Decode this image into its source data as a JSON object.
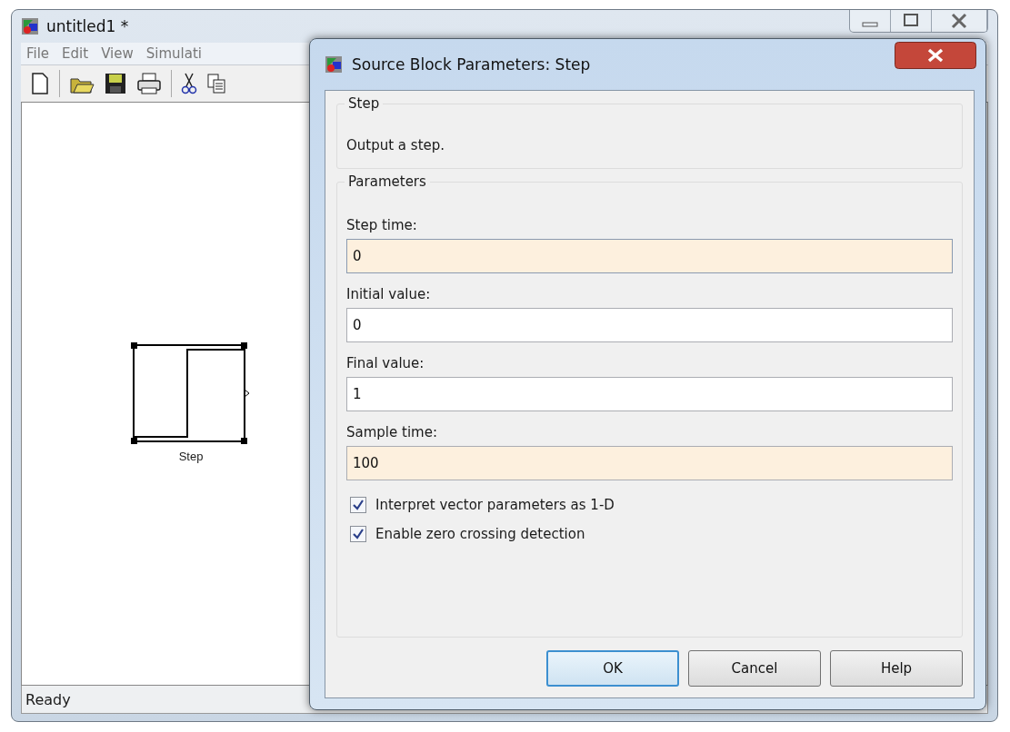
{
  "main_window": {
    "title": "untitled1 *",
    "menu": [
      {
        "label": "File"
      },
      {
        "label": "Edit"
      },
      {
        "label": "View"
      },
      {
        "label": "Simulati"
      }
    ],
    "canvas": {
      "blocks": [
        {
          "label": "Step",
          "selected": true
        }
      ]
    },
    "status_bar": {
      "text": "Ready"
    }
  },
  "dialog": {
    "title": "Source Block Parameters: Step",
    "description_group": {
      "title": "Step",
      "text": "Output a step."
    },
    "parameters_group": {
      "title": "Parameters",
      "fields": [
        {
          "label": "Step time:",
          "value": "0",
          "modified": true,
          "focused": true
        },
        {
          "label": "Initial value:",
          "value": "0",
          "modified": false,
          "focused": false
        },
        {
          "label": "Final value:",
          "value": "1",
          "modified": false,
          "focused": false
        },
        {
          "label": "Sample time:",
          "value": "100",
          "modified": true,
          "focused": false
        }
      ],
      "checkboxes": [
        {
          "label": "Interpret vector parameters as 1-D",
          "checked": true
        },
        {
          "label": "Enable zero crossing detection",
          "checked": true
        }
      ]
    },
    "buttons": [
      {
        "label": "OK",
        "default": true
      },
      {
        "label": "Cancel",
        "default": false
      },
      {
        "label": "Help",
        "default": false
      }
    ]
  }
}
